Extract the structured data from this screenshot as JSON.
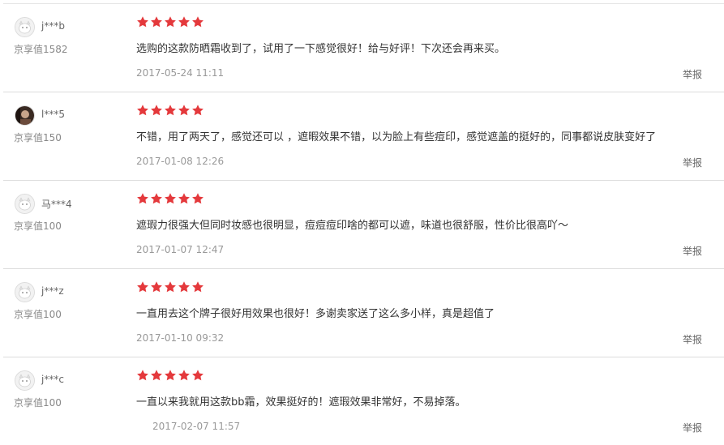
{
  "colors": {
    "star": "#e4393c",
    "divider": "#dddddd"
  },
  "icons": {
    "star": "star-icon",
    "avatar": "avatar-icon"
  },
  "reviews": [
    {
      "username": "j***b",
      "level": "京享值1582",
      "rating": 5,
      "content": "选购的这款防晒霜收到了，试用了一下感觉很好！给与好评！下次还会再来买。",
      "date": "2017-05-24 11:11",
      "report_label": "举报",
      "avatar": "default"
    },
    {
      "username": "l***5",
      "level": "京享值150",
      "rating": 5,
      "content": "不错，用了两天了，感觉还可以 ，遮暇效果不错，以为脸上有些痘印，感觉遮盖的挺好的，同事都说皮肤变好了",
      "date": "2017-01-08 12:26",
      "report_label": "举报",
      "avatar": "photo"
    },
    {
      "username": "马***4",
      "level": "京享值100",
      "rating": 5,
      "content": "遮瑕力很强大但同时妆感也很明显，痘痘痘印啥的都可以遮，味道也很舒服，性价比很高吖～",
      "date": "2017-01-07 12:47",
      "report_label": "举报",
      "avatar": "default"
    },
    {
      "username": "j***z",
      "level": "京享值100",
      "rating": 5,
      "content": "一直用去这个牌子很好用效果也很好！多谢卖家送了这么多小样，真是超值了",
      "date": "2017-01-10 09:32",
      "report_label": "举报",
      "avatar": "default"
    },
    {
      "username": "j***c",
      "level": "京享值100",
      "rating": 5,
      "content": "一直以来我就用这款bb霜，效果挺好的！遮瑕效果非常好，不易掉落。",
      "date": "2017-02-07 11:57",
      "report_label": "举报",
      "avatar": "default"
    }
  ]
}
